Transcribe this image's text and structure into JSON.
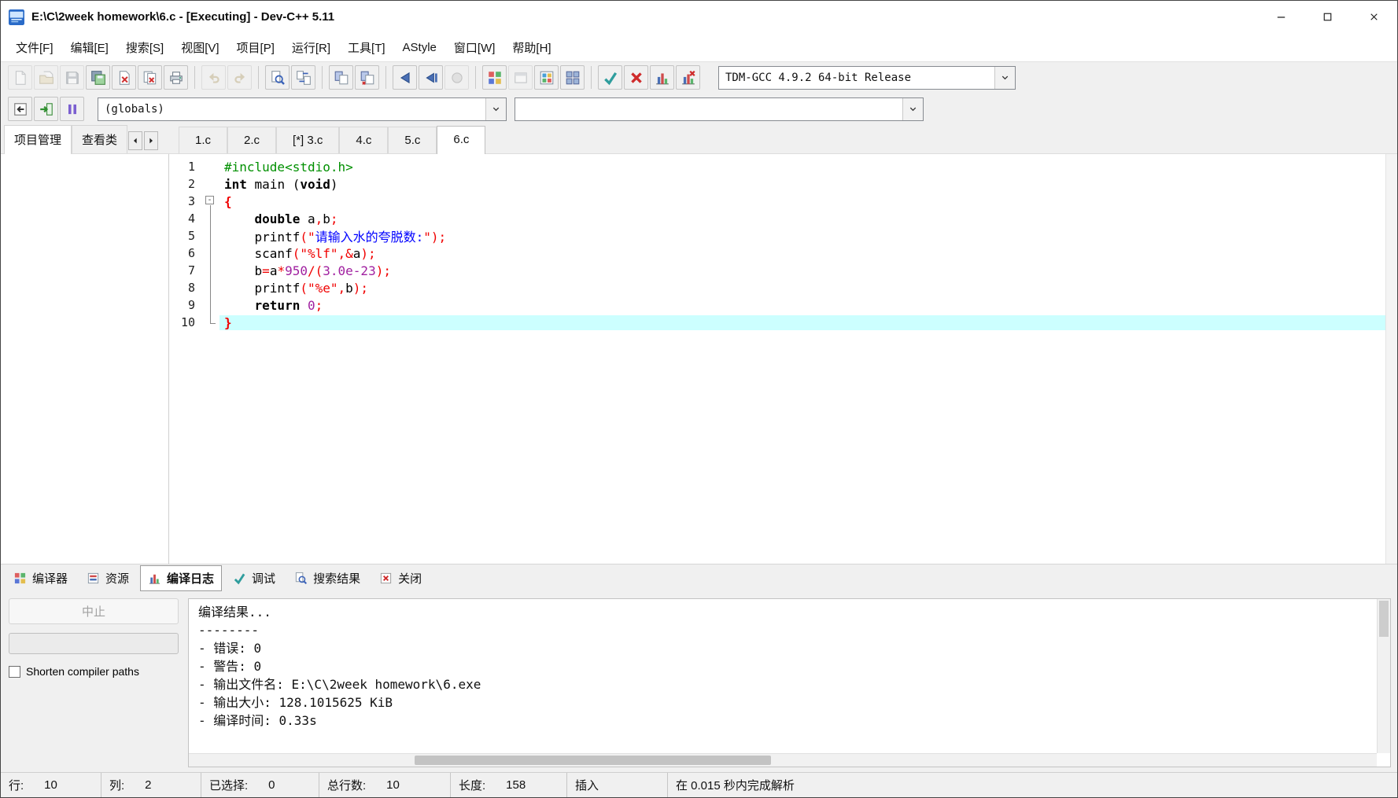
{
  "window": {
    "title": "E:\\C\\2week homework\\6.c - [Executing] - Dev-C++ 5.11"
  },
  "menu": {
    "items": [
      {
        "id": "file",
        "label": "文件[F]"
      },
      {
        "id": "edit",
        "label": "编辑[E]"
      },
      {
        "id": "search",
        "label": "搜索[S]"
      },
      {
        "id": "view",
        "label": "视图[V]"
      },
      {
        "id": "project",
        "label": "项目[P]"
      },
      {
        "id": "run",
        "label": "运行[R]"
      },
      {
        "id": "tools",
        "label": "工具[T]"
      },
      {
        "id": "astyle",
        "label": "AStyle"
      },
      {
        "id": "window",
        "label": "窗口[W]"
      },
      {
        "id": "help",
        "label": "帮助[H]"
      }
    ]
  },
  "toolbar1": {
    "compiler_select": "TDM-GCC 4.9.2 64-bit Release",
    "groups": [
      {
        "buttons": [
          {
            "id": "new-file",
            "icon": "page",
            "disabled": true
          },
          {
            "id": "open-file",
            "icon": "folder-page",
            "disabled": true
          },
          {
            "id": "save",
            "icon": "floppy",
            "disabled": true
          },
          {
            "id": "save-all",
            "icon": "floppy-all",
            "disabled": false
          },
          {
            "id": "close-file",
            "icon": "page-close",
            "disabled": false
          },
          {
            "id": "close-all",
            "icon": "pages-close",
            "disabled": false
          },
          {
            "id": "print",
            "icon": "printer",
            "disabled": false
          }
        ]
      },
      {
        "buttons": [
          {
            "id": "undo",
            "icon": "undo",
            "disabled": true
          },
          {
            "id": "redo",
            "icon": "redo",
            "disabled": true
          }
        ]
      },
      {
        "buttons": [
          {
            "id": "find",
            "icon": "find",
            "disabled": false
          },
          {
            "id": "replace",
            "icon": "replace",
            "disabled": false
          }
        ]
      },
      {
        "buttons": [
          {
            "id": "compile",
            "icon": "compile",
            "disabled": false
          },
          {
            "id": "rebuild",
            "icon": "rebuild",
            "disabled": false
          }
        ]
      },
      {
        "buttons": [
          {
            "id": "run",
            "icon": "run",
            "disabled": false
          },
          {
            "id": "compile-run",
            "icon": "run-small",
            "disabled": false
          },
          {
            "id": "pause",
            "icon": "circle",
            "disabled": true
          }
        ]
      },
      {
        "buttons": [
          {
            "id": "new-project",
            "icon": "grid4",
            "disabled": false
          },
          {
            "id": "close-project",
            "icon": "window",
            "disabled": true
          },
          {
            "id": "project-options",
            "icon": "grid-color",
            "disabled": false
          },
          {
            "id": "window-layout",
            "icon": "grid-mini",
            "disabled": false
          }
        ]
      },
      {
        "buttons": [
          {
            "id": "debug",
            "icon": "check",
            "disabled": false
          },
          {
            "id": "abort",
            "icon": "redx",
            "disabled": false
          },
          {
            "id": "profile",
            "icon": "chart",
            "disabled": false
          },
          {
            "id": "delete-profile",
            "icon": "chart-x",
            "disabled": false
          }
        ]
      }
    ]
  },
  "toolbar2": {
    "globals_select": "(globals)",
    "members_select": "",
    "groups": [
      {
        "buttons": [
          {
            "id": "jump-back",
            "icon": "nav-back",
            "disabled": false
          },
          {
            "id": "goto-definition",
            "icon": "nav-into",
            "disabled": false
          },
          {
            "id": "pause-program",
            "icon": "pause-bars",
            "disabled": false
          }
        ]
      }
    ]
  },
  "panel_tabs": {
    "left": [
      "项目管理",
      "查看类"
    ]
  },
  "editor": {
    "tabs": [
      {
        "label": "1.c"
      },
      {
        "label": "2.c"
      },
      {
        "label": "[*] 3.c"
      },
      {
        "label": "4.c"
      },
      {
        "label": "5.c"
      },
      {
        "label": "6.c",
        "active": true
      }
    ],
    "lines": [
      {
        "n": 1,
        "fold": "",
        "hl": false,
        "toks": [
          [
            "pre",
            "#include<stdio.h>"
          ]
        ]
      },
      {
        "n": 2,
        "fold": "",
        "hl": false,
        "toks": [
          [
            "kw",
            "int"
          ],
          [
            "pl",
            " main ("
          ],
          [
            "kw",
            "void"
          ],
          [
            "pl",
            ")"
          ]
        ]
      },
      {
        "n": 3,
        "fold": "start",
        "hl": false,
        "toks": [
          [
            "brace",
            "{"
          ]
        ]
      },
      {
        "n": 4,
        "fold": "line",
        "hl": false,
        "toks": [
          [
            "pl",
            "    "
          ],
          [
            "kw",
            "double"
          ],
          [
            "pl",
            " a"
          ],
          [
            "sym",
            ","
          ],
          [
            "pl",
            "b"
          ],
          [
            "sym",
            ";"
          ]
        ]
      },
      {
        "n": 5,
        "fold": "line",
        "hl": false,
        "toks": [
          [
            "pl",
            "    printf"
          ],
          [
            "sym",
            "("
          ],
          [
            "str",
            "\""
          ],
          [
            "cjk",
            "请输入水的夸脱数:"
          ],
          [
            "str",
            "\""
          ],
          [
            "sym",
            ");"
          ]
        ]
      },
      {
        "n": 6,
        "fold": "line",
        "hl": false,
        "toks": [
          [
            "pl",
            "    scanf"
          ],
          [
            "sym",
            "("
          ],
          [
            "str",
            "\"%lf\""
          ],
          [
            "sym",
            ",&"
          ],
          [
            "pl",
            "a"
          ],
          [
            "sym",
            ");"
          ]
        ]
      },
      {
        "n": 7,
        "fold": "line",
        "hl": false,
        "toks": [
          [
            "pl",
            "    b"
          ],
          [
            "sym",
            "="
          ],
          [
            "pl",
            "a"
          ],
          [
            "sym",
            "*"
          ],
          [
            "num",
            "950"
          ],
          [
            "sym",
            "/("
          ],
          [
            "num",
            "3.0e-23"
          ],
          [
            "sym",
            ");"
          ]
        ]
      },
      {
        "n": 8,
        "fold": "line",
        "hl": false,
        "toks": [
          [
            "pl",
            "    printf"
          ],
          [
            "sym",
            "("
          ],
          [
            "str",
            "\"%e\""
          ],
          [
            "sym",
            ","
          ],
          [
            "pl",
            "b"
          ],
          [
            "sym",
            ");"
          ]
        ]
      },
      {
        "n": 9,
        "fold": "line",
        "hl": false,
        "toks": [
          [
            "pl",
            "    "
          ],
          [
            "kw",
            "return"
          ],
          [
            "pl",
            " "
          ],
          [
            "num",
            "0"
          ],
          [
            "sym",
            ";"
          ]
        ]
      },
      {
        "n": 10,
        "fold": "end",
        "hl": true,
        "toks": [
          [
            "brace",
            "}"
          ]
        ]
      }
    ]
  },
  "bottom_tabs": [
    {
      "id": "compiler",
      "label": "编译器",
      "icon": "grid4"
    },
    {
      "id": "resources",
      "label": "资源",
      "icon": "res"
    },
    {
      "id": "compile-log",
      "label": "编译日志",
      "icon": "chart",
      "active": true
    },
    {
      "id": "debug-tab",
      "label": "调试",
      "icon": "check"
    },
    {
      "id": "search-results",
      "label": "搜索结果",
      "icon": "find"
    },
    {
      "id": "close-panel",
      "label": "关闭",
      "icon": "close-box"
    }
  ],
  "compile_panel": {
    "abort_label": "中止",
    "shorten_label": "Shorten compiler paths",
    "log": [
      "编译结果...",
      "--------",
      "- 错误: 0",
      "- 警告: 0",
      "- 输出文件名: E:\\C\\2week homework\\6.exe",
      "- 输出大小: 128.1015625 KiB",
      "- 编译时间: 0.33s"
    ]
  },
  "status": {
    "segments": [
      {
        "id": "line",
        "label": "行:",
        "value": "10"
      },
      {
        "id": "column",
        "label": "列:",
        "value": "2"
      },
      {
        "id": "selected",
        "label": "已选择:",
        "value": "0"
      },
      {
        "id": "total-lines",
        "label": "总行数:",
        "value": "10"
      },
      {
        "id": "length",
        "label": "长度:",
        "value": "158"
      },
      {
        "id": "insert-mode",
        "label": "插入"
      },
      {
        "id": "parse-status",
        "label": "在 0.015 秒内完成解析"
      }
    ]
  }
}
